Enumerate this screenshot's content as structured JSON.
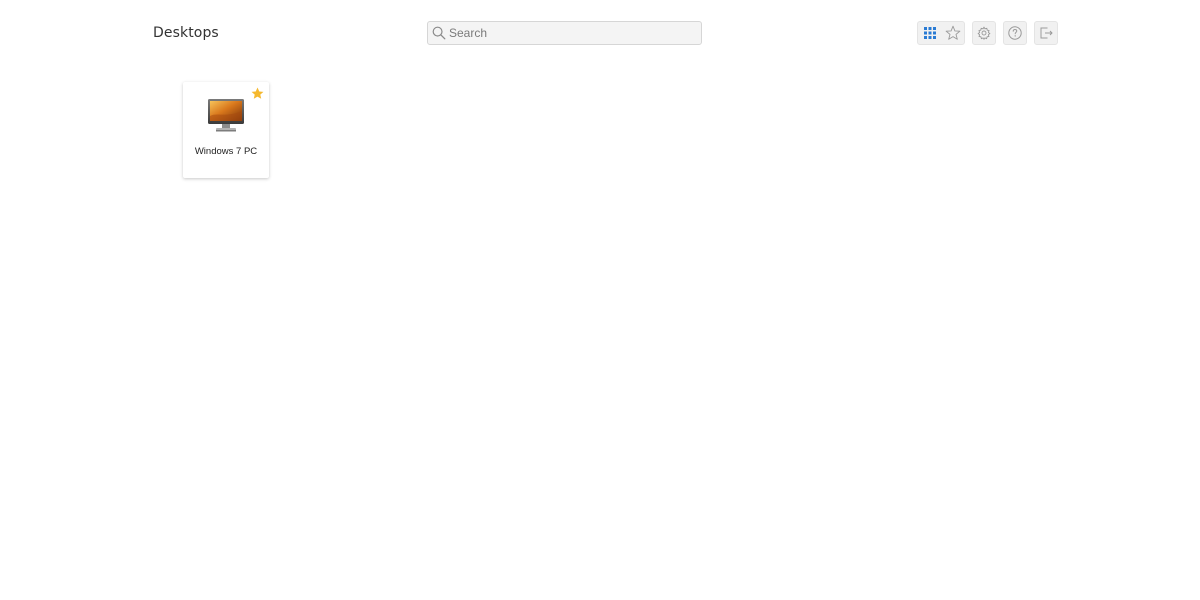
{
  "header": {
    "title": "Desktops",
    "search": {
      "placeholder": "Search",
      "value": "",
      "icon": "search-icon"
    },
    "toolbar": {
      "buttons": [
        {
          "name": "grid-view",
          "icon": "grid-icon",
          "active": true,
          "color": "#2a7bd4"
        },
        {
          "name": "favorites-view",
          "icon": "star-outline-icon",
          "active": false
        },
        {
          "name": "settings",
          "icon": "gear-icon"
        },
        {
          "name": "help",
          "icon": "help-icon"
        },
        {
          "name": "logout",
          "icon": "logout-icon"
        }
      ]
    }
  },
  "desktops": [
    {
      "label": "Windows 7 PC",
      "icon": "monitor-icon",
      "favorite": true,
      "favorite_color": "#f5b82e"
    }
  ]
}
